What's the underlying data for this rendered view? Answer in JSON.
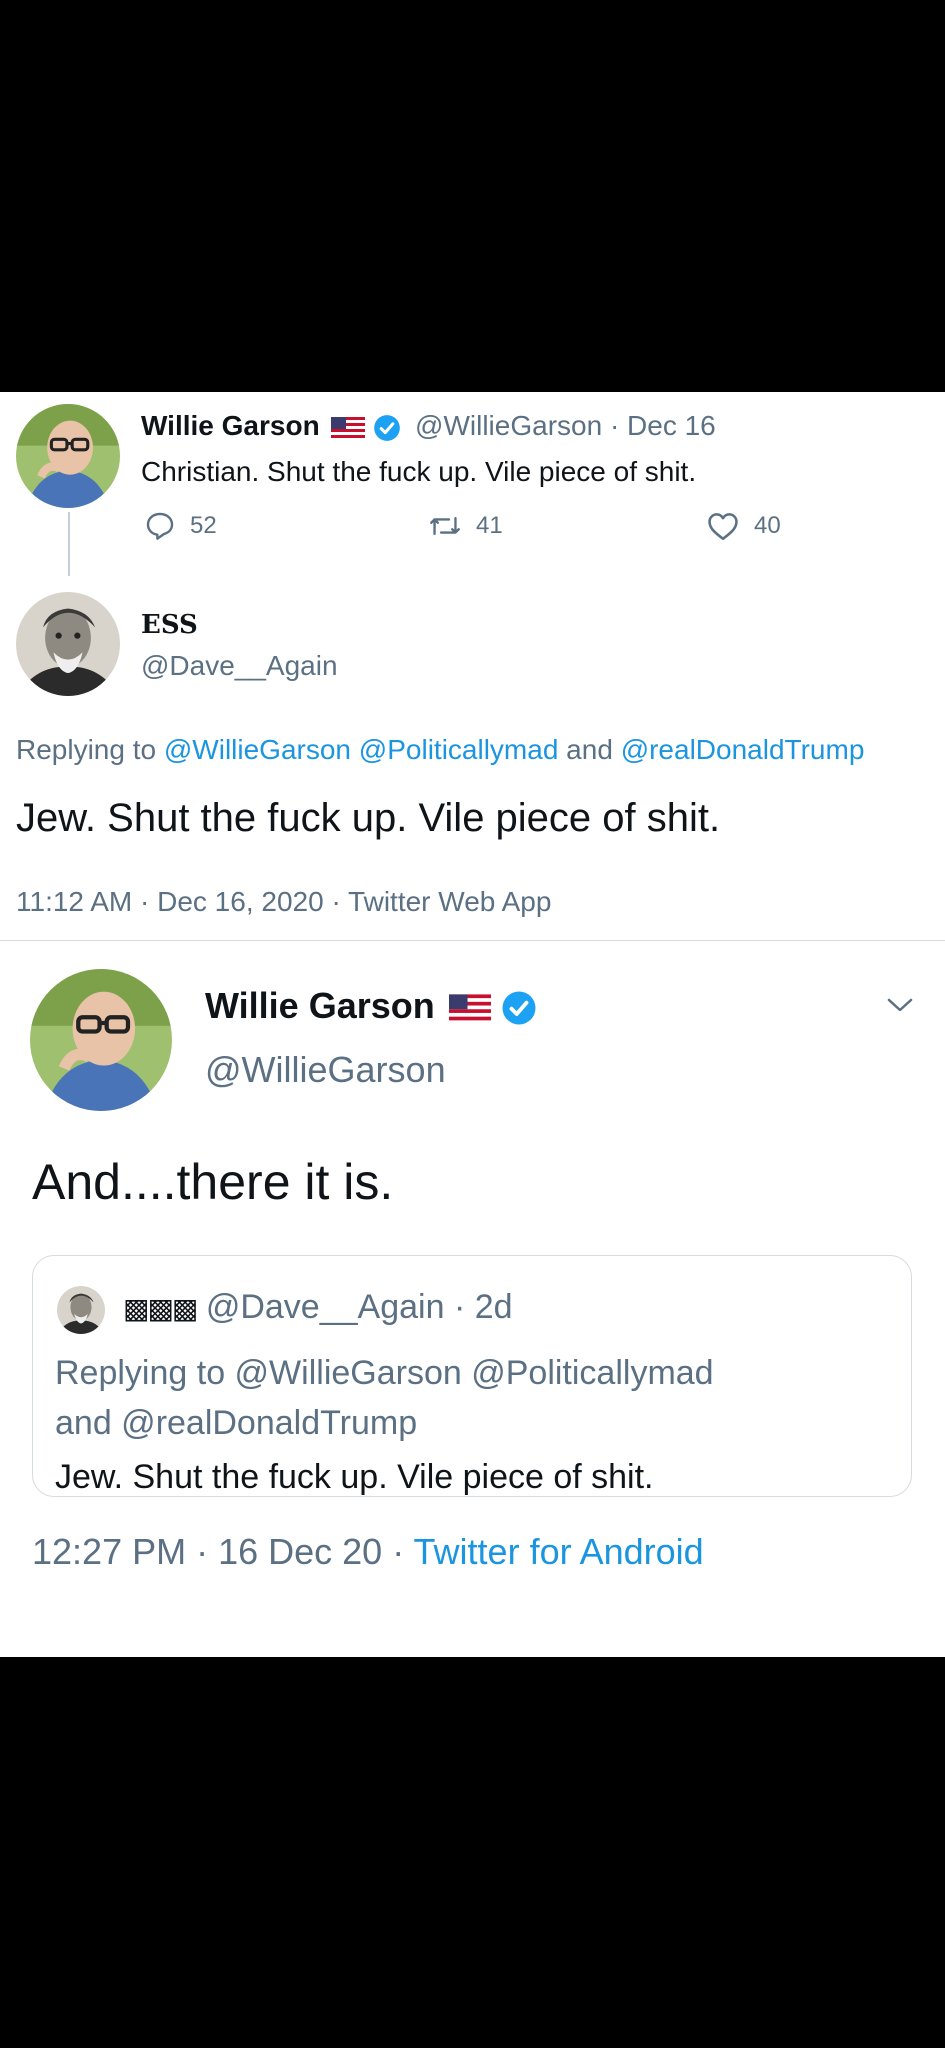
{
  "tweet1": {
    "display_name": "Willie Garson",
    "handle_date": "@WillieGarson · Dec 16",
    "text": "Christian. Shut the fuck up. Vile piece of shit.",
    "replies": "52",
    "retweets": "41",
    "likes": "40"
  },
  "reply": {
    "display_name": "ESS",
    "handle": "@Dave__Again",
    "replying_prefix": "Replying to ",
    "mention1": "@WillieGarson",
    "mention2": "@Politicallymad",
    "and_word": " and ",
    "mention3": "@realDonaldTrump",
    "text": "Jew. Shut the fuck up. Vile piece of shit.",
    "timestamp": "11:12 AM · Dec 16, 2020 · Twitter Web App"
  },
  "tweet2": {
    "display_name": "Willie Garson",
    "handle": "@WillieGarson",
    "text": "And....there it is.",
    "quote": {
      "name_glyphs": "▩▩▩",
      "handle_time": "@Dave__Again · 2d",
      "replying_line1": "Replying to @WillieGarson @Politicallymad",
      "replying_line2": "and @realDonaldTrump",
      "text": "Jew. Shut the fuck up. Vile piece of shit."
    },
    "timestamp_prefix": "12:27 PM · 16 Dec 20 · ",
    "source": "Twitter for Android"
  },
  "colors": {
    "link": "#1b95e0",
    "gray": "#5b7083",
    "verified": "#1da1f2"
  },
  "icons": [
    "us-flag-icon",
    "verified-badge-icon",
    "reply-icon",
    "retweet-icon",
    "like-icon",
    "chevron-down-icon"
  ]
}
